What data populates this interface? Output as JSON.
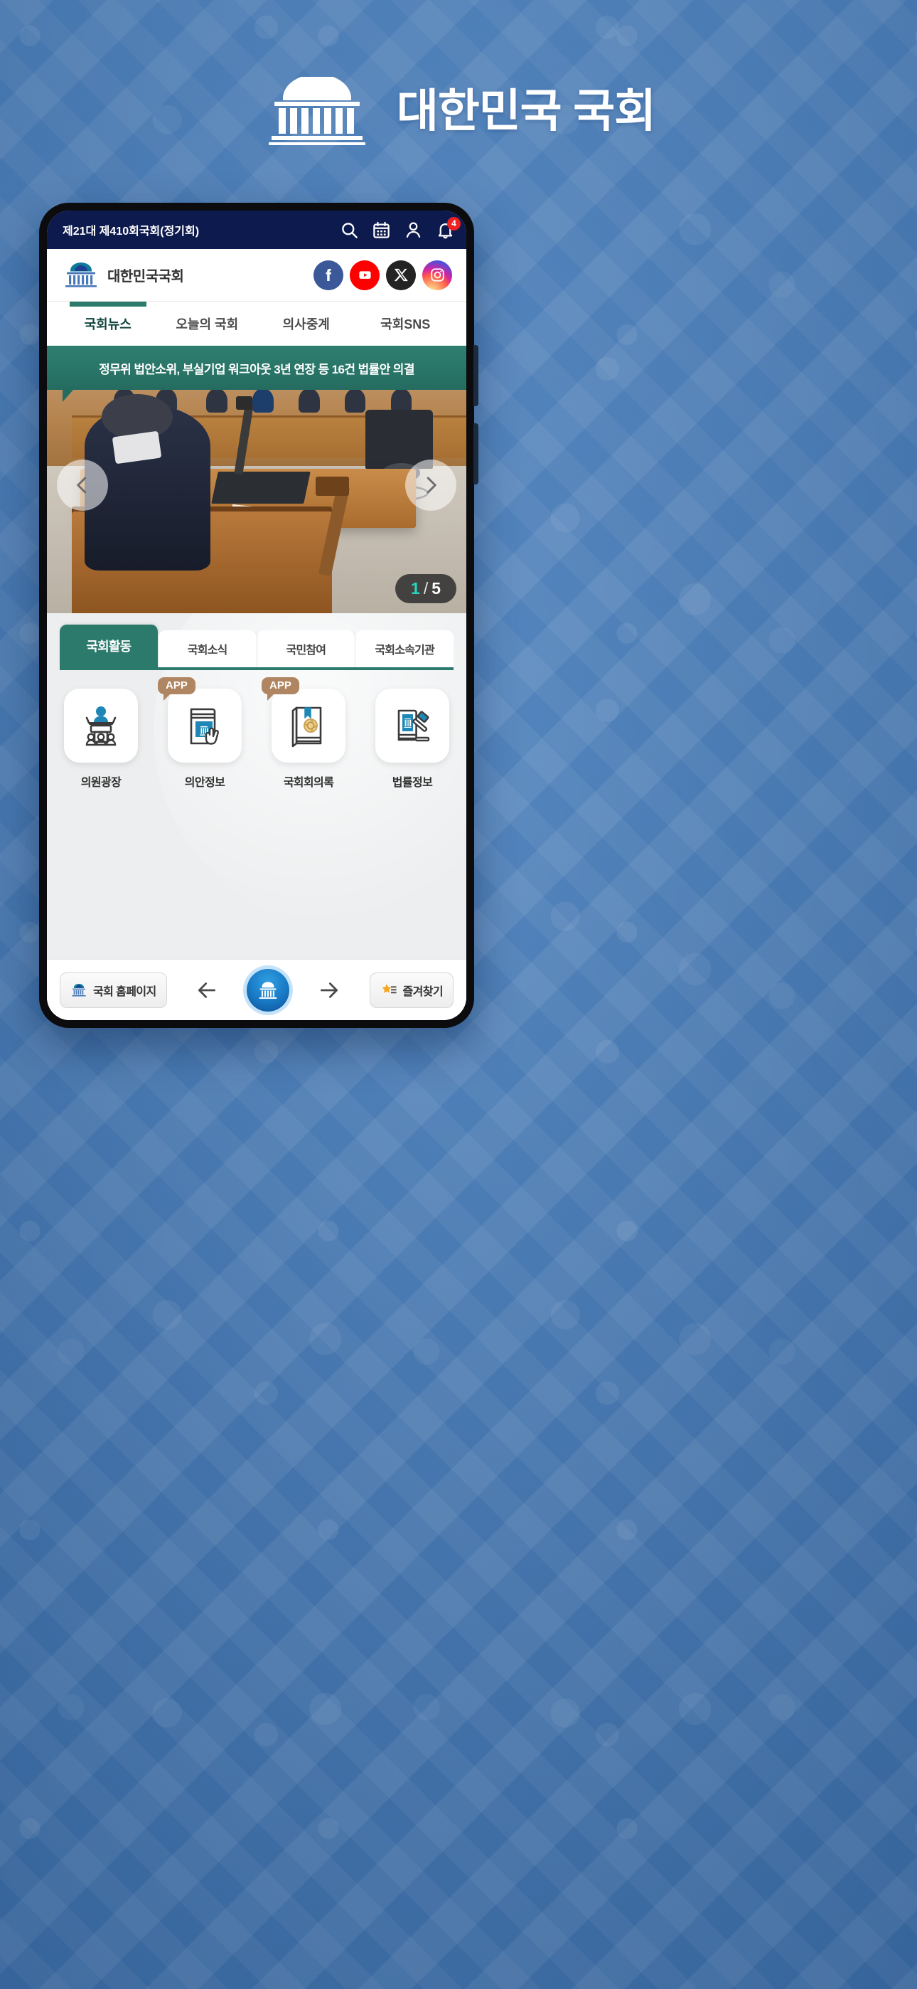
{
  "page": {
    "brand_title": "대한민국 국회",
    "brand_emblem_icon": "assembly-building-icon"
  },
  "app": {
    "topbar": {
      "session_title": "제21대 제410회국회(정기회)",
      "icons": [
        {
          "name": "search-icon",
          "label": "검색"
        },
        {
          "name": "calendar-icon",
          "label": "일정"
        },
        {
          "name": "person-icon",
          "label": "내정보"
        },
        {
          "name": "bell-icon",
          "label": "알림"
        }
      ],
      "notification_count": "4",
      "background_color": "#0d1a4e",
      "badge_color": "#ef2222"
    },
    "site_header": {
      "logo_text": "대한민국국회",
      "logo_icon": "assembly-building-icon",
      "sns": [
        {
          "name": "facebook-icon",
          "label": "Facebook",
          "color": "#3b5998"
        },
        {
          "name": "youtube-icon",
          "label": "YouTube",
          "color": "#ff0000"
        },
        {
          "name": "x-twitter-icon",
          "label": "X",
          "color": "#232323"
        },
        {
          "name": "instagram-icon",
          "label": "Instagram",
          "color": "#d6249f"
        }
      ]
    },
    "nav_tabs": [
      {
        "label": "국회뉴스",
        "active": true
      },
      {
        "label": "오늘의 국회",
        "active": false
      },
      {
        "label": "의사중계",
        "active": false
      },
      {
        "label": "국회SNS",
        "active": false
      }
    ],
    "nav_active_color": "#2b7a6c",
    "hero": {
      "headline": "정무위 법안소위, 부실기업 워크아웃 3년 연장 등 16건 법률안 의결",
      "banner_color": "#2b7a6c",
      "counter_current": "1",
      "counter_separator": "/",
      "counter_total": "5",
      "counter_current_color": "#2ad4c0",
      "prev_icon": "chevron-left-icon",
      "next_icon": "chevron-right-icon",
      "photo_alt": "국회 상임위원회 회의장에서 의사봉을 든 위원장"
    },
    "card_tabs": [
      {
        "label": "국회활동",
        "active": true
      },
      {
        "label": "국회소식",
        "active": false
      },
      {
        "label": "국민참여",
        "active": false
      },
      {
        "label": "국회소속기관",
        "active": false
      }
    ],
    "quicklinks": [
      {
        "label": "의원광장",
        "icon": "podium-speaker-icon",
        "badge": ""
      },
      {
        "label": "의안정보",
        "icon": "book-tap-hand-icon",
        "badge": "APP"
      },
      {
        "label": "국회회의록",
        "icon": "book-seal-icon",
        "badge": "APP"
      },
      {
        "label": "법률정보",
        "icon": "book-gavel-icon",
        "badge": ""
      }
    ],
    "quicklink_badge_color": "#b08561",
    "bottom_bar": {
      "homepage_label": "국회 홈페이지",
      "homepage_icon": "assembly-building-icon",
      "back_icon": "arrow-left-icon",
      "home_icon": "assembly-building-icon",
      "forward_icon": "arrow-right-icon",
      "favorites_label": "즐겨찾기",
      "favorites_icon": "star-list-icon"
    }
  }
}
